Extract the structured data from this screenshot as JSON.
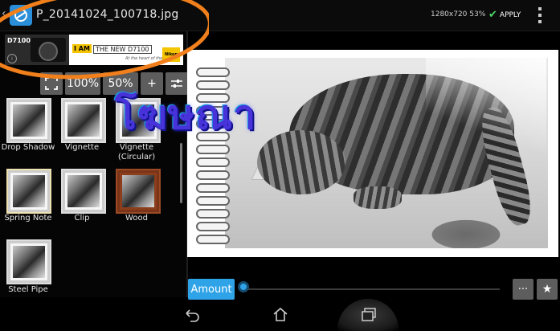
{
  "header": {
    "filename": "P_20141024_100718.jpg",
    "resolution_info": "1280x720 53%",
    "apply_label": "APPLY"
  },
  "ad": {
    "model": "D7100",
    "iam": "I AM",
    "new_text": "THE NEW D7100",
    "tagline": "At the heart of the image",
    "brand": "Nikon"
  },
  "zoom": {
    "hundred_label": "100%",
    "fifty_label": "50%",
    "plus_label": "+"
  },
  "effects": [
    {
      "label": "Drop Shadow"
    },
    {
      "label": "Vignette"
    },
    {
      "label": "Vignette (Circular)"
    },
    {
      "label": "Spring Note"
    },
    {
      "label": "Clip"
    },
    {
      "label": "Wood"
    },
    {
      "label": "Steel Pipe"
    }
  ],
  "watermark": "โฆษณา",
  "controls": {
    "amount_label": "Amount",
    "amount_value": 0,
    "more_label": "···",
    "star_label": "★"
  },
  "colors": {
    "accent": "#2fa3e8",
    "apply_check": "#4cd964",
    "watermark": "#4733d9",
    "annotation_ring": "#f07f1c"
  }
}
